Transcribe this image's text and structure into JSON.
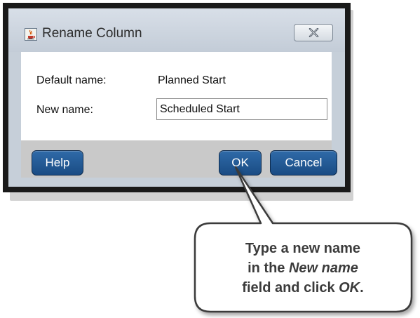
{
  "dialog": {
    "title": "Rename Column",
    "icon": "java-cup-icon",
    "close_icon": "close-x-icon"
  },
  "form": {
    "default_name_label": "Default name:",
    "default_name_value": "Planned Start",
    "new_name_label": "New name:",
    "new_name_value": "Scheduled Start"
  },
  "buttons": {
    "help": "Help",
    "ok": "OK",
    "cancel": "Cancel"
  },
  "callout": {
    "line1": "Type a new name",
    "line2_prefix": "in the ",
    "line2_emphasis": "New name",
    "line3_prefix": "field and click ",
    "line3_emphasis": "OK",
    "line3_suffix": "."
  },
  "colors": {
    "button_blue": "#1a4c84",
    "frame": "#1a1a1a",
    "title_bar": "#c9d2dc",
    "button_bar": "#c9c9c9"
  }
}
